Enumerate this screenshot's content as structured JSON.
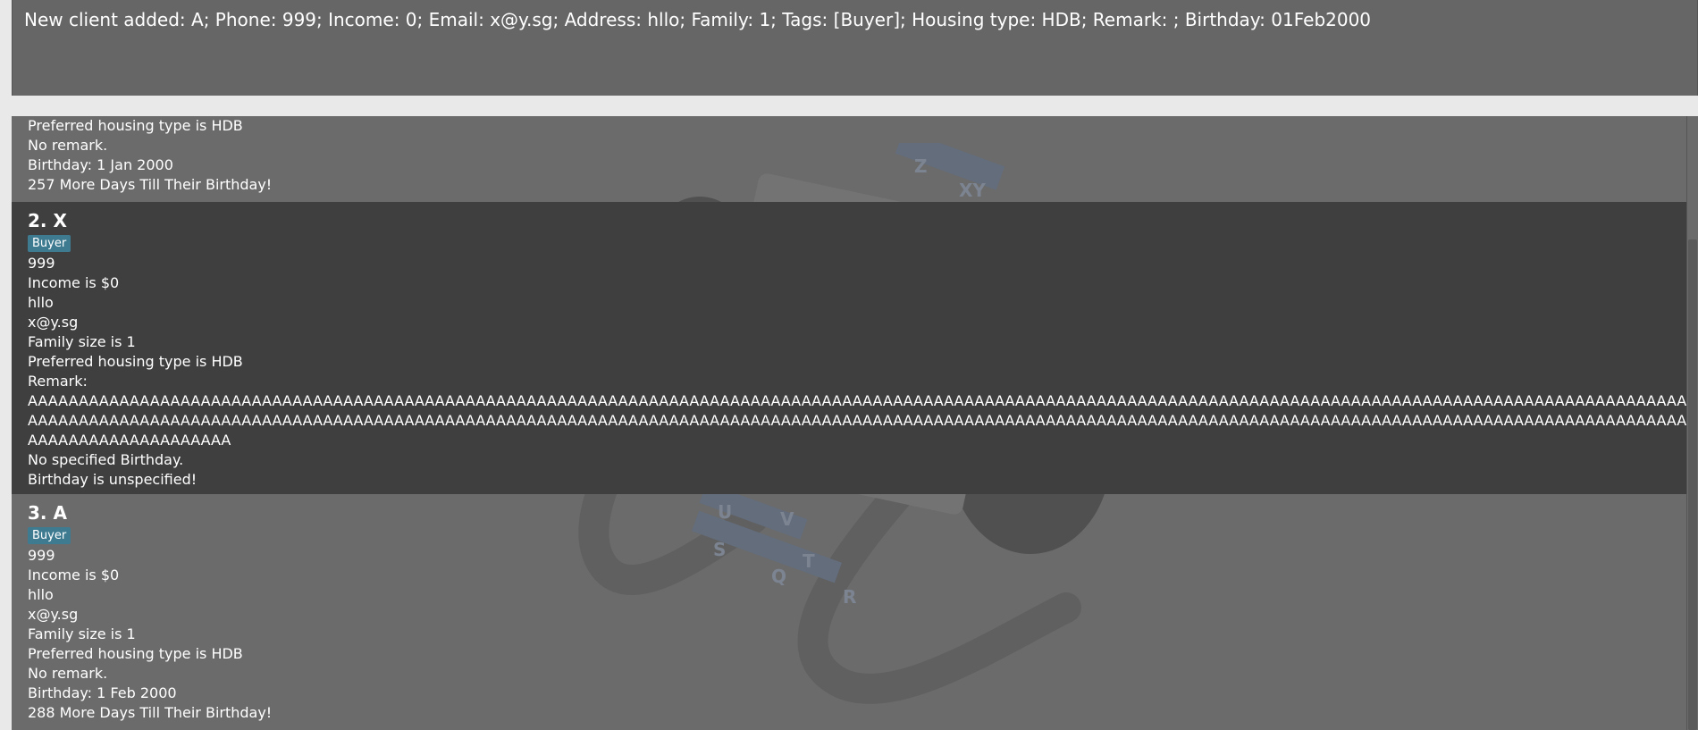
{
  "result_display": {
    "message": "New client added: A; Phone: 999; Income: 0; Email: x@y.sg; Address: hllo; Family: 1; Tags: [Buyer]; Housing type: HDB; Remark: ; Birthday: 01Feb2000"
  },
  "clients_partial_top": {
    "housing": "Preferred housing type is HDB",
    "remark": "No remark.",
    "birthday": "Birthday: 1 Jan 2000",
    "countdown": "257 More Days Till Their Birthday!"
  },
  "clients": [
    {
      "index_name": "2.  X",
      "tag": "Buyer",
      "phone": "999",
      "income": "Income is $0",
      "address": "hllo",
      "email": "x@y.sg",
      "family": "Family size is 1",
      "housing": "Preferred housing type is HDB",
      "remark_label": "Remark:",
      "remark_text": "AAAAAAAAAAAAAAAAAAAAAAAAAAAAAAAAAAAAAAAAAAAAAAAAAAAAAAAAAAAAAAAAAAAAAAAAAAAAAAAAAAAAAAAAAAAAAAAAAAAAAAAAAAAAAAAAAAAAAAAAAAAAAAAAAAAAAAAAAAAAAAAAAAAAAAAAAAAAAAAAAAAAAAAAAAAAAAAAAAAAAAAAAAAAAAAAAAAAAAAAAAAAAAAAAAAAAAAAAAAAAAAAAAAAAAAAAAAAAAAAAAAAAAAAAAAAAAAAAAAAAAAAAAAAAAAAAAAAAAAAAAAAAAAAAAAAAAAAAAAAAAAAAAAAAAAAAAAAAAAAAAAAAAAAAAAAAAAAAAAAAAAAAA",
      "birthday": "No specified Birthday.",
      "countdown": "Birthday is unspecified!"
    },
    {
      "index_name": "3.  A",
      "tag": "Buyer",
      "phone": "999",
      "income": "Income is $0",
      "address": "hllo",
      "email": "x@y.sg",
      "family": "Family size is 1",
      "housing": "Preferred housing type is HDB",
      "remark": "No remark.",
      "birthday": "Birthday: 1 Feb 2000",
      "countdown": "288 More Days Till Their Birthday!"
    }
  ],
  "watermark": {
    "icon": "rolodex-icon",
    "labels": [
      "Z",
      "XY",
      "U",
      "V",
      "S",
      "T",
      "Q",
      "R"
    ]
  },
  "colors": {
    "result_bg": "#666666",
    "list_bg": "#6b6b6b",
    "selected_card_bg": "#3f3f3f",
    "tag_bg": "#3e7b91",
    "text": "#ffffff"
  }
}
